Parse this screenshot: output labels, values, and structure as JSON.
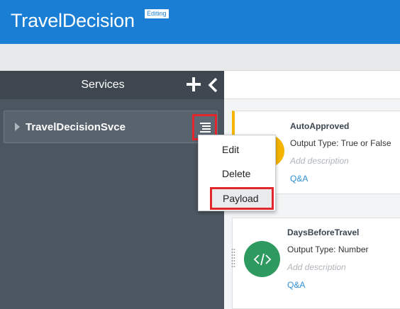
{
  "app": {
    "title": "TravelDecision",
    "mode_badge": "Editing"
  },
  "sidebar": {
    "title": "Services",
    "add_icon": "plus-icon",
    "collapse_icon": "chevron-left-icon",
    "services": [
      {
        "name": "TravelDecisionSvce",
        "menu_icon": "hamburger-menu-icon"
      }
    ]
  },
  "context_menu": {
    "items": [
      "Edit",
      "Delete",
      "Payload"
    ],
    "highlighted": "Payload"
  },
  "decisions": [
    {
      "name": "AutoApproved",
      "output": "Output Type: True or False",
      "description_placeholder": "Add description",
      "link": "Q&A",
      "icon_color": "#f4b400"
    },
    {
      "name": "DaysBeforeTravel",
      "output": "Output Type: Number",
      "description_placeholder": "Add description",
      "link": "Q&A",
      "icon_color": "#2f9a5f",
      "icon": "code-icon"
    }
  ],
  "colors": {
    "brand": "#1a7fd4",
    "highlight": "#e3262c",
    "sidebar": "#4c5660"
  }
}
